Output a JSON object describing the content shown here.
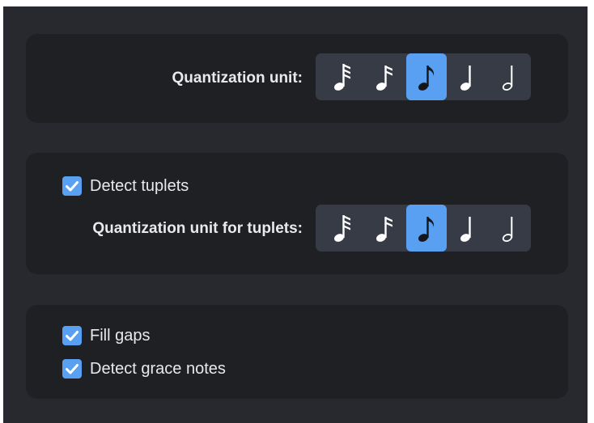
{
  "quantization": {
    "label": "Quantization unit:",
    "options": [
      {
        "icon": "thirty-second-note-icon",
        "selected": false
      },
      {
        "icon": "sixteenth-note-icon",
        "selected": false
      },
      {
        "icon": "eighth-note-icon",
        "selected": true
      },
      {
        "icon": "quarter-note-icon",
        "selected": false
      },
      {
        "icon": "half-note-icon",
        "selected": false
      }
    ]
  },
  "tuplets": {
    "detect_label": "Detect tuplets",
    "detect_checked": true,
    "unit_label": "Quantization unit for tuplets:",
    "options": [
      {
        "icon": "thirty-second-note-icon",
        "selected": false
      },
      {
        "icon": "sixteenth-note-icon",
        "selected": false
      },
      {
        "icon": "eighth-note-icon",
        "selected": true
      },
      {
        "icon": "quarter-note-icon",
        "selected": false
      },
      {
        "icon": "half-note-icon",
        "selected": false
      }
    ]
  },
  "options": {
    "fill_gaps_label": "Fill gaps",
    "fill_gaps_checked": true,
    "grace_notes_label": "Detect grace notes",
    "grace_notes_checked": true
  },
  "colors": {
    "background": "#27292e",
    "panel": "#1e2024",
    "segment": "#363b45",
    "accent": "#5aa0f2",
    "text": "#e8e9ec"
  }
}
